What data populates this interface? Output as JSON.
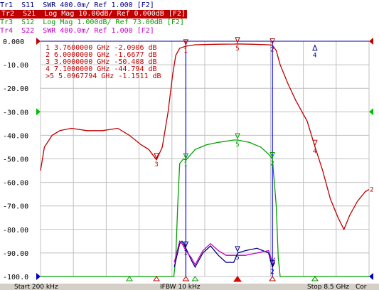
{
  "traces": [
    {
      "id": "Tr1",
      "label": "Tr1  S11  SWR 400.0m/ Ref 1.000 [F2]",
      "color": "#000080",
      "active": false
    },
    {
      "id": "Tr2",
      "label": "Tr2  S21  Log Mag 10.00dB/ Ref 0.000dB [F2]",
      "color": "#c00000",
      "active": true
    },
    {
      "id": "Tr3",
      "label": "Tr3  S12  Log Mag 1.000dB/ Ref 73.00dB [F2]",
      "color": "#00a000",
      "active": false
    },
    {
      "id": "Tr4",
      "label": "Tr4  S22  SWR 400.0m/ Ref 1.000 [F2]",
      "color": "#c000c0",
      "active": false
    }
  ],
  "markers": [
    {
      "id": "1",
      "freq": "3.7600000 GHz",
      "value": "-2.0906 dB",
      "active": false
    },
    {
      "id": "2",
      "freq": "6.0000000 GHz",
      "value": "-1.6677 dB",
      "active": false
    },
    {
      "id": "3",
      "freq": "3.0000000 GHz",
      "value": "-50.408 dB",
      "active": false
    },
    {
      "id": "4",
      "freq": "7.1000000 GHz",
      "value": "-44.794 dB",
      "active": false
    },
    {
      "id": "5",
      "freq": "5.0967794 GHz",
      "value": "-1.1511 dB",
      "active": true
    }
  ],
  "status_bar": {
    "start": "Start 200 kHz",
    "ifbw": "IFBW 10 kHz",
    "stop": "Stop 8.5 GHz",
    "cor": "Cor"
  },
  "chart_data": {
    "type": "line",
    "xlim": [
      0.0002,
      8.5
    ],
    "ylim": [
      -100,
      0
    ],
    "y_ticks": [
      "0.000",
      "-10.00",
      "-20.00",
      "-30.00",
      "-40.00",
      "-50.00",
      "-60.00",
      "-70.00",
      "-80.00",
      "-90.00",
      "-100.0"
    ],
    "grid": true,
    "series": [
      {
        "name": "S21",
        "color": "#c00000",
        "x": [
          0.0002,
          0.1,
          0.3,
          0.5,
          0.8,
          1.2,
          1.6,
          2.0,
          2.3,
          2.6,
          2.8,
          3.0,
          3.15,
          3.3,
          3.42,
          3.5,
          3.6,
          3.76,
          4.0,
          4.5,
          5.0,
          5.1,
          5.5,
          5.9,
          6.0,
          6.1,
          6.2,
          6.4,
          6.6,
          6.9,
          7.1,
          7.3,
          7.5,
          7.7,
          7.85,
          8.0,
          8.2,
          8.4,
          8.5
        ],
        "y": [
          -55,
          -45,
          -40,
          -38,
          -37,
          -38,
          -38,
          -37,
          -40,
          -44,
          -46,
          -50.4,
          -45,
          -30,
          -14,
          -6,
          -3,
          -2.1,
          -1.5,
          -1.3,
          -1.2,
          -1.15,
          -1.3,
          -1.5,
          -1.7,
          -4,
          -10,
          -18,
          -25,
          -34,
          -44.8,
          -55,
          -67,
          -75,
          -80,
          -74,
          -68,
          -64,
          -63
        ]
      },
      {
        "name": "S12",
        "color": "#00a000",
        "x": [
          0.0002,
          3.45,
          3.5,
          3.55,
          3.6,
          3.7,
          3.76,
          4.0,
          4.3,
          4.6,
          5.0,
          5.1,
          5.4,
          5.7,
          5.9,
          6.0,
          6.1,
          6.15,
          6.2,
          8.5
        ],
        "y": [
          -100,
          -100,
          -92,
          -70,
          -52,
          -50,
          -50.5,
          -46,
          -44,
          -43,
          -42,
          -42,
          -43,
          -45,
          -48,
          -50,
          -70,
          -92,
          -100,
          -100
        ]
      },
      {
        "name": "S11",
        "color": "#000080",
        "x": [
          3.46,
          3.6,
          3.66,
          3.76,
          3.9,
          4.0,
          4.2,
          4.4,
          4.6,
          4.8,
          5.0,
          5.1,
          5.3,
          5.6,
          5.9,
          6.0,
          6.06
        ],
        "y": [
          -96,
          -86,
          -85,
          -88,
          -93,
          -96,
          -90,
          -87,
          -91,
          -94,
          -94,
          -90,
          -89,
          -88,
          -90,
          -96,
          -94
        ]
      },
      {
        "name": "S22",
        "color": "#c000c0",
        "x": [
          3.46,
          3.6,
          3.66,
          3.76,
          3.9,
          4.0,
          4.2,
          4.4,
          4.6,
          4.8,
          5.0,
          5.1,
          5.3,
          5.6,
          5.9,
          6.0,
          6.06
        ],
        "y": [
          -94,
          -85,
          -86,
          -89,
          -92,
          -95,
          -89,
          -86,
          -89,
          -91,
          -91,
          -91,
          -91,
          -90,
          -89,
          -94,
          -92
        ]
      }
    ],
    "marker_points": [
      {
        "id": "1",
        "x": 3.76,
        "y": -2.0906,
        "color": "#c00000"
      },
      {
        "id": "2",
        "x": 6.0,
        "y": -1.6677,
        "color": "#c00000"
      },
      {
        "id": "3",
        "x": 3.0,
        "y": -50.408,
        "color": "#c00000"
      },
      {
        "id": "4",
        "x": 7.1,
        "y": -44.794,
        "color": "#c00000"
      },
      {
        "id": "5",
        "x": 5.0967794,
        "y": -1.1511,
        "color": "#c00000"
      },
      {
        "id": "1",
        "x": 3.76,
        "y": -50.5,
        "color": "#00a000"
      },
      {
        "id": "2",
        "x": 6.0,
        "y": -50,
        "color": "#00a000"
      },
      {
        "id": "5",
        "x": 5.0967794,
        "y": -42,
        "color": "#00a000"
      },
      {
        "id": "1",
        "x": 3.76,
        "y": -88,
        "color": "#000080"
      },
      {
        "id": "2",
        "x": 6.0,
        "y": -96,
        "color": "#000080"
      },
      {
        "id": "5",
        "x": 5.0967794,
        "y": -90,
        "color": "#000080"
      }
    ],
    "bottom_markers": [
      {
        "id": "1",
        "x": 3.76
      },
      {
        "id": "2",
        "x": 6.0
      },
      {
        "id": "3",
        "x": 3.0
      },
      {
        "id": "4",
        "x": 7.1
      },
      {
        "id": "5",
        "x": 5.0967794
      }
    ],
    "top_markers": [
      {
        "id": "4",
        "x": 7.1,
        "y": -2
      }
    ]
  }
}
